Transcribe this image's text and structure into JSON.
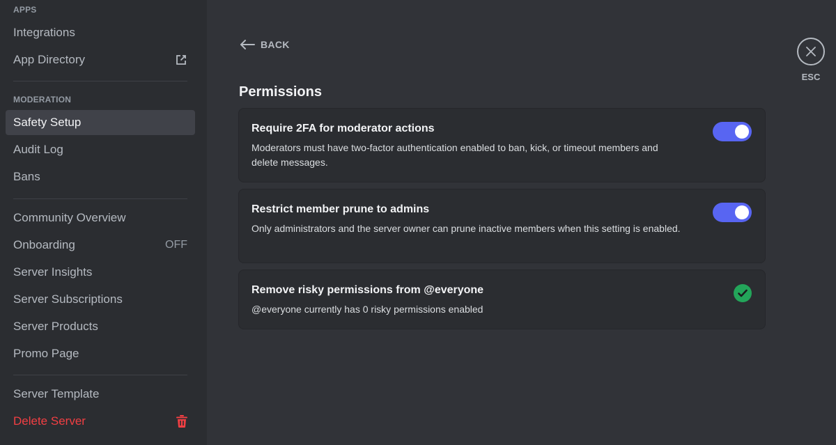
{
  "sidebar": {
    "apps_header": "APPS",
    "moderation_header": "MODERATION",
    "items": [
      {
        "label": "Integrations"
      },
      {
        "label": "App Directory",
        "icon": "external-link-icon"
      },
      {
        "label": "Safety Setup",
        "active": true
      },
      {
        "label": "Audit Log"
      },
      {
        "label": "Bans"
      },
      {
        "label": "Community Overview"
      },
      {
        "label": "Onboarding",
        "trail": "OFF"
      },
      {
        "label": "Server Insights"
      },
      {
        "label": "Server Subscriptions"
      },
      {
        "label": "Server Products"
      },
      {
        "label": "Promo Page"
      },
      {
        "label": "Server Template"
      },
      {
        "label": "Delete Server",
        "icon": "trash-icon",
        "color": "#f23f43"
      }
    ]
  },
  "main": {
    "back_label": "BACK",
    "title": "Permissions",
    "cards": [
      {
        "title": "Require 2FA for moderator actions",
        "desc": "Moderators must have two-factor authentication enabled to ban, kick, or timeout members and delete messages.",
        "control": "toggle",
        "enabled": true
      },
      {
        "title": "Restrict member prune to admins",
        "desc": "Only administrators and the server owner can prune inactive members when this setting is enabled.",
        "control": "toggle",
        "enabled": true
      },
      {
        "title": "Remove risky permissions from @everyone",
        "desc": "@everyone currently has 0 risky permissions enabled",
        "control": "check-icon"
      }
    ]
  },
  "close": {
    "label": "ESC",
    "icon": "close-icon"
  },
  "colors": {
    "background": "#313338",
    "sidebar": "#2b2d31",
    "accent": "#5865f2",
    "danger": "#f23f43",
    "success": "#23a55a"
  }
}
